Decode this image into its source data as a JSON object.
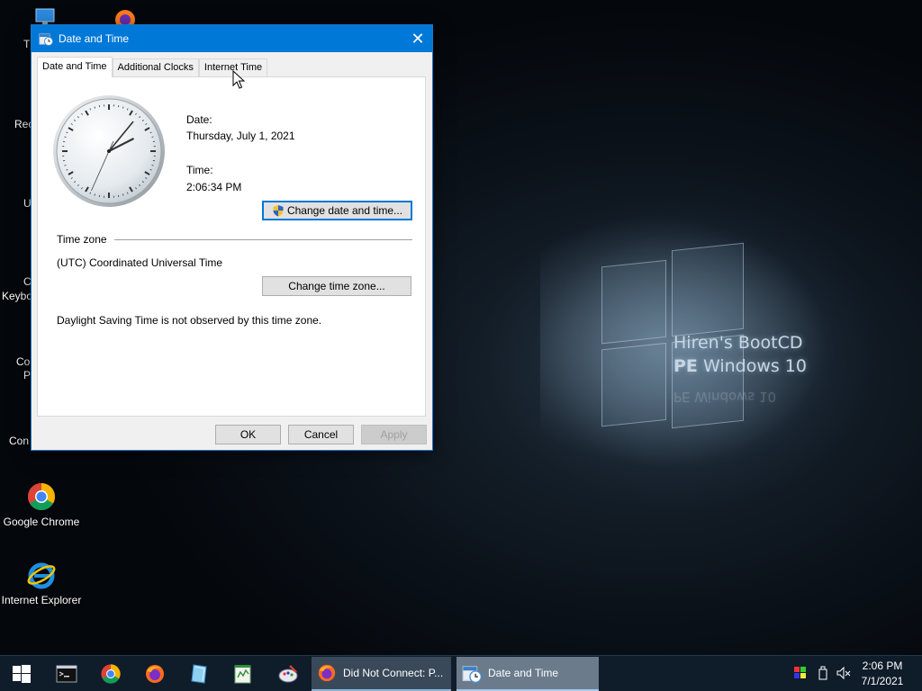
{
  "desktop": {
    "watermark_line1": "Hiren's BootCD",
    "watermark_line2_bold": "PE",
    "watermark_line2_rest": " Windows 10",
    "watermark_reflect": "PE Windows 10",
    "icons": [
      {
        "label": "Google Chrome",
        "icon": "chrome-icon"
      },
      {
        "label": "Internet Explorer",
        "icon": "ie-icon"
      }
    ],
    "partial_labels": [
      "T",
      "Rec",
      "U",
      "C",
      "Keybo",
      "Co",
      "P",
      "Con"
    ]
  },
  "dialog": {
    "title": "Date and Time",
    "close_glyph": "✕",
    "tabs": [
      {
        "label": "Date and Time",
        "active": true
      },
      {
        "label": "Additional Clocks",
        "active": false
      },
      {
        "label": "Internet Time",
        "active": false
      }
    ],
    "date_label": "Date:",
    "date_value": "Thursday, July 1, 2021",
    "time_label": "Time:",
    "time_value": "2:06:34 PM",
    "change_datetime_button": "Change date and time...",
    "timezone_heading": "Time zone",
    "timezone_value": "(UTC) Coordinated Universal Time",
    "change_timezone_button": "Change time zone...",
    "dst_note": "Daylight Saving Time is not observed by this time zone.",
    "ok_button": "OK",
    "cancel_button": "Cancel",
    "apply_button": "Apply",
    "apply_disabled": true,
    "clock": {
      "hours": 2,
      "minutes": 6,
      "seconds": 34
    }
  },
  "taskbar": {
    "pinned": [
      "start-icon",
      "terminal-icon",
      "chrome-icon",
      "firefox-icon",
      "explorer-icon",
      "notepad-icon",
      "paint-icon"
    ],
    "tasks": [
      {
        "label": "Did Not Connect: P...",
        "icon": "firefox-icon"
      },
      {
        "label": "Date and Time",
        "icon": "datetime-icon"
      }
    ],
    "tray_time": "2:06 PM",
    "tray_date": "7/1/2021"
  },
  "colors": {
    "titlebar": "#0078d7",
    "taskbar": "#0f1c2a",
    "active_task": "#6b7b8c"
  }
}
